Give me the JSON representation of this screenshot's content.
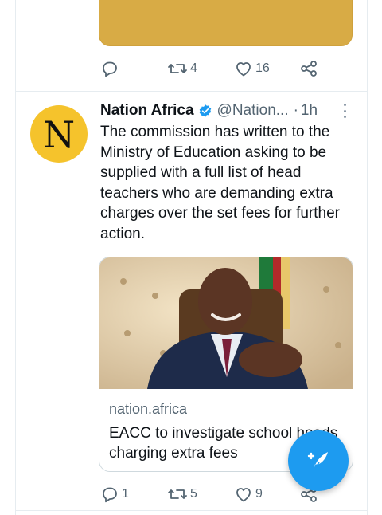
{
  "previous_tweet": {
    "retweet_count": "4",
    "like_count": "16"
  },
  "tweet": {
    "avatar_letter": "N",
    "author_name": "Nation Africa",
    "handle": "@Nation...",
    "separator": "·",
    "time": "1h",
    "text": "The commission has written to the Ministry of Education asking to be supplied with a full list of head teachers who are demanding extra charges over the set fees for further action.",
    "card": {
      "domain": "nation.africa",
      "title": "EACC to investigate school heads charging extra fees"
    },
    "reply_count": "1",
    "retweet_count": "5",
    "like_count": "9"
  },
  "icons": {
    "reply": "reply-icon",
    "retweet": "retweet-icon",
    "like": "heart-icon",
    "share": "share-icon",
    "verified": "verified-badge-icon",
    "more": "more-options-icon",
    "compose": "compose-tweet-icon"
  },
  "colors": {
    "accent": "#1d9bf0",
    "avatar_bg": "#f5c32c",
    "previous_media": "#d8ab45"
  }
}
